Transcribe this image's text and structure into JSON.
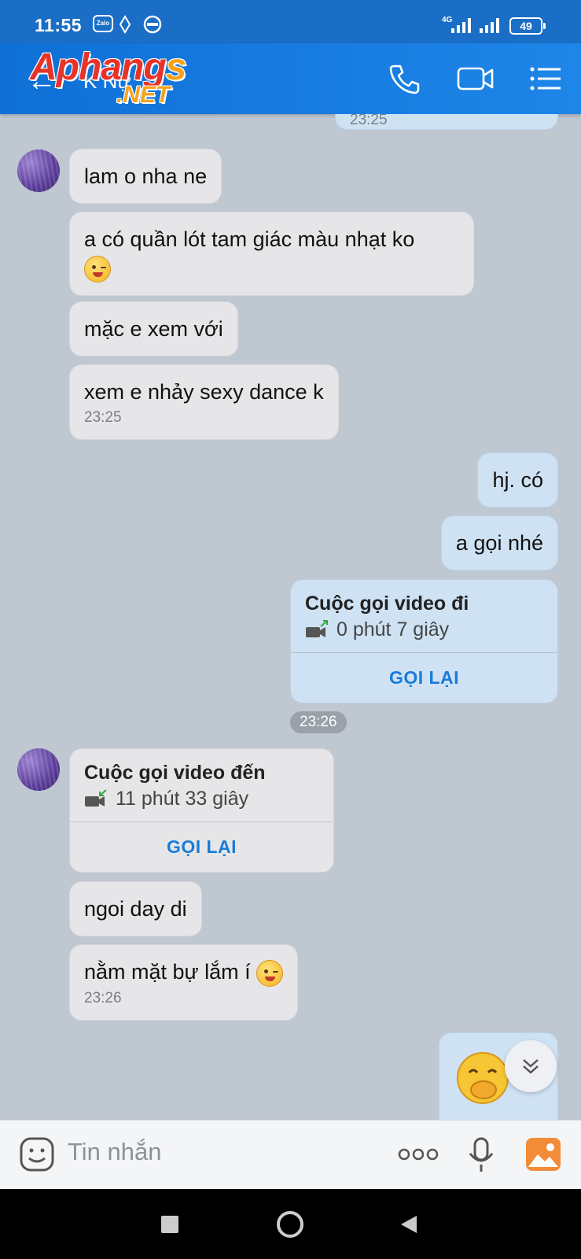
{
  "status": {
    "time": "11:55",
    "network": "4G",
    "battery": "49"
  },
  "header": {
    "contact": "K Nự",
    "watermark_main": "Aphang",
    "watermark_s": "s",
    "watermark_sub": ".NET"
  },
  "messages": {
    "prev_time": "23:25",
    "m1": "lam o nha ne",
    "m2": "a có quần lót tam giác màu nhạt ko",
    "m3": "mặc e xem với",
    "m4": "xem e nhảy sexy dance k",
    "m4_time": "23:25",
    "o1": "hj. có",
    "o2": "a gọi nhé",
    "call_out_title": "Cuộc gọi video đi",
    "call_out_duration": "0 phút 7 giây",
    "call_out_action": "GỌI LẠI",
    "chip_time": "23:26",
    "call_in_title": "Cuộc gọi video đến",
    "call_in_duration": "11 phút 33 giây",
    "call_in_action": "GỌI LẠI",
    "m5": "ngoi day di",
    "m6": "nằm mặt bự lắm í",
    "m6_time": "23:26"
  },
  "input": {
    "placeholder": "Tin nhắn"
  },
  "colors": {
    "header": "#1e86e8",
    "accent": "#1a7bd8",
    "incoming": "#e6e6e9",
    "outgoing": "#cfe2f3"
  },
  "icons": [
    "phone-icon",
    "video-icon",
    "menu-icon",
    "sticker-icon",
    "more-icon",
    "mic-icon",
    "gallery-icon",
    "scroll-down-icon"
  ]
}
